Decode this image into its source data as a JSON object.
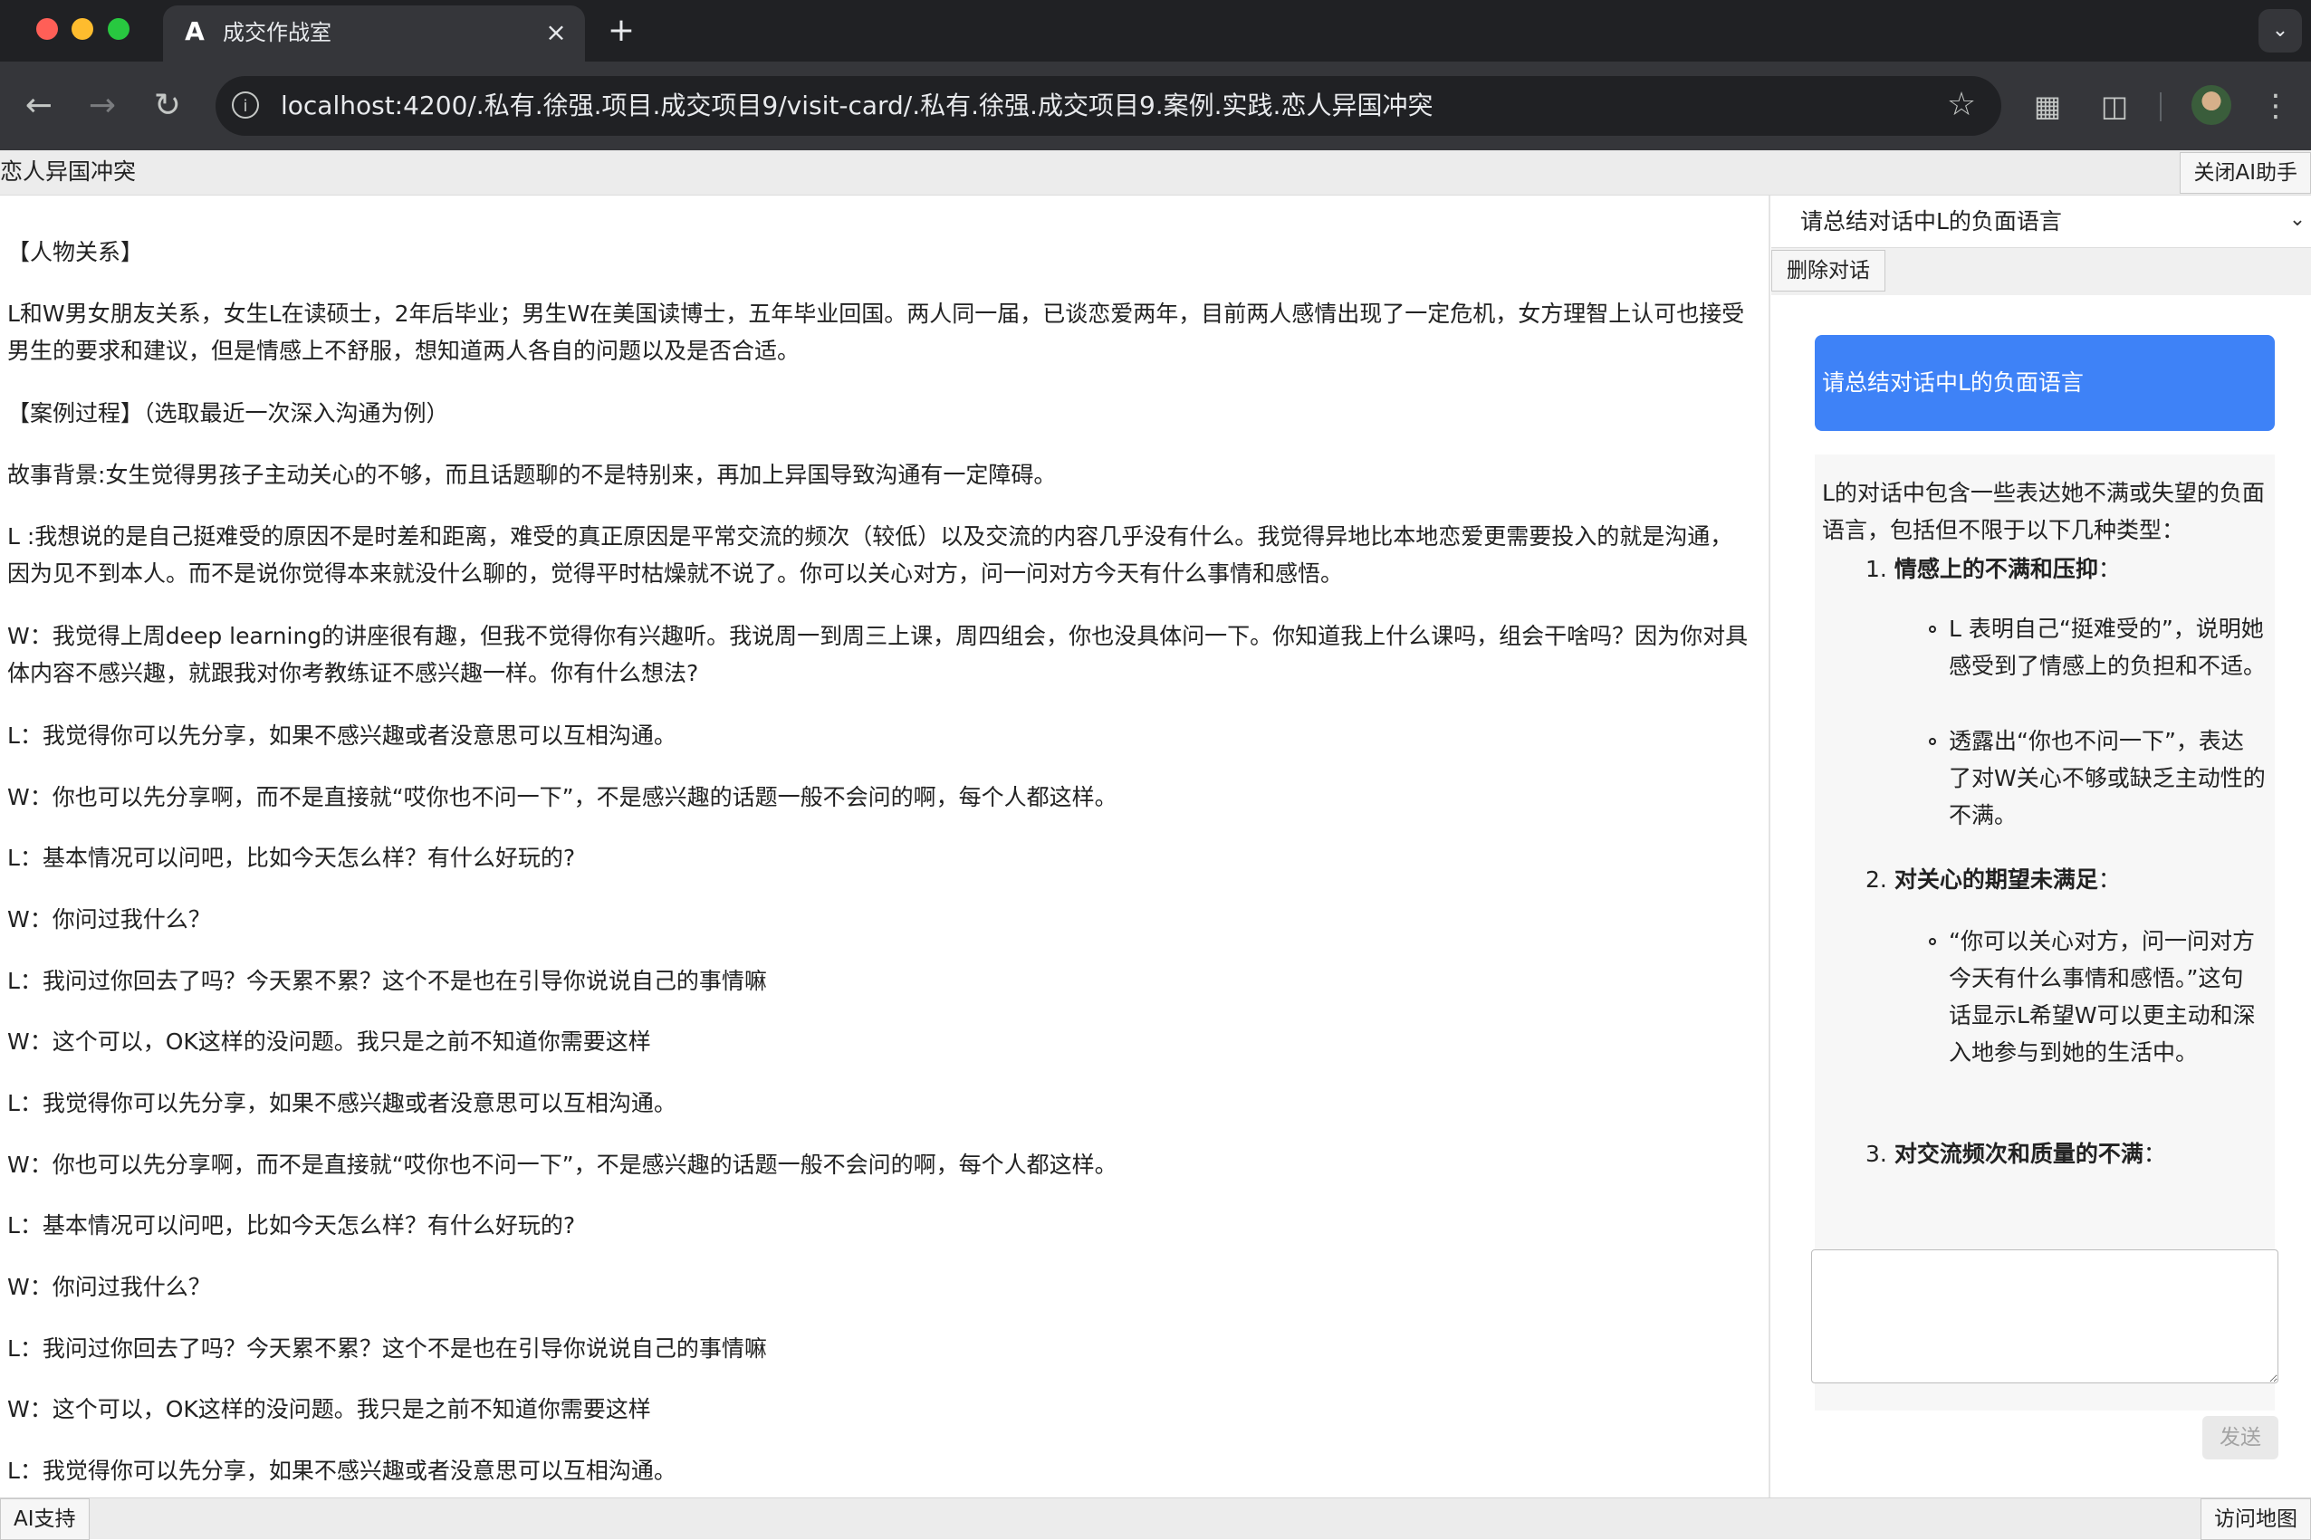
{
  "browser": {
    "tab_title": "成交作战室",
    "tab_favicon": "A",
    "tab_close": "×",
    "new_tab": "+",
    "url": "localhost:4200/.私有.徐强.项目.成交项目9/visit-card/.私有.徐强.成交项目9.案例.实践.恋人异国冲突",
    "icons": [
      "back-icon",
      "forward-icon",
      "reload-icon",
      "info-icon",
      "star-icon",
      "qr-code-icon",
      "extensions-icon",
      "profile-avatar",
      "menu-icon"
    ]
  },
  "header": {
    "title": "恋人异国冲突",
    "close_ai_label": "关闭AI助手"
  },
  "case": {
    "paragraphs": [
      "【人物关系】",
      "L和W男女朋友关系，女生L在读硕士，2年后毕业；男生W在美国读博士，五年毕业回国。两人同一届，已谈恋爱两年，目前两人感情出现了一定危机，女方理智上认可也接受男生的要求和建议，但是情感上不舒服，想知道两人各自的问题以及是否合适。",
      "【案例过程】（选取最近一次深入沟通为例）",
      "故事背景:女生觉得男孩子主动关心的不够，而且话题聊的不是特别来，再加上异国导致沟通有一定障碍。",
      "L :我想说的是自己挺难受的原因不是时差和距离，难受的真正原因是平常交流的频次（较低）以及交流的内容几乎没有什么。我觉得异地比本地恋爱更需要投入的就是沟通，因为见不到本人。而不是说你觉得本来就没什么聊的，觉得平时枯燥就不说了。你可以关心对方，问一问对方今天有什么事情和感悟。",
      "W：我觉得上周deep learning的讲座很有趣，但我不觉得你有兴趣听。我说周一到周三上课，周四组会，你也没具体问一下。你知道我上什么课吗，组会干啥吗？因为你对具体内容不感兴趣，就跟我对你考教练证不感兴趣一样。你有什么想法?",
      "L：我觉得你可以先分享，如果不感兴趣或者没意思可以互相沟通。",
      "W：你也可以先分享啊，而不是直接就“哎你也不问一下”，不是感兴趣的话题一般不会问的啊，每个人都这样。",
      "L：基本情况可以问吧，比如今天怎么样？有什么好玩的?",
      "W：你问过我什么？",
      "L：我问过你回去了吗？今天累不累？这个不是也在引导你说说自己的事情嘛",
      "W：这个可以，OK这样的没问题。我只是之前不知道你需要这样",
      "L：我觉得你可以先分享，如果不感兴趣或者没意思可以互相沟通。",
      "W：你也可以先分享啊，而不是直接就“哎你也不问一下”，不是感兴趣的话题一般不会问的啊，每个人都这样。",
      "L：基本情况可以问吧，比如今天怎么样？有什么好玩的?",
      "W：你问过我什么？",
      "L：我问过你回去了吗？今天累不累？这个不是也在引导你说说自己的事情嘛",
      "W：这个可以，OK这样的没问题。我只是之前不知道你需要这样",
      "L：我觉得你可以先分享，如果不感兴趣或者没意思可以互相沟通。"
    ]
  },
  "ai": {
    "selected_prompt": "请总结对话中L的负面语言",
    "delete_label": "删除对话",
    "user_message": "请总结对话中L的负面语言",
    "reply": {
      "intro": "L的对话中包含一些表达她不满或失望的负面语言，包括但不限于以下几种类型：",
      "items": [
        {
          "number": "1.",
          "heading": "情感上的不满和压抑",
          "colon": "：",
          "bullets": [
            "L 表明自己“挺难受的”，说明她感受到了情感上的负担和不适。",
            "透露出“你也不问一下”，表达了对W关心不够或缺乏主动性的不满。"
          ]
        },
        {
          "number": "2.",
          "heading": "对关心的期望未满足",
          "colon": "：",
          "bullets": [
            "“你可以关心对方，问一问对方今天有什么事情和感悟。”这句话显示L希望W可以更主动和深入地参与到她的生活中。"
          ]
        },
        {
          "number": "3.",
          "heading": "对交流频次和质量的不满",
          "colon": "：",
          "bullets": []
        }
      ]
    },
    "input_value": "",
    "send_label": "发送"
  },
  "footer": {
    "ai_support_label": "AI支持",
    "map_label": "访问地图"
  }
}
